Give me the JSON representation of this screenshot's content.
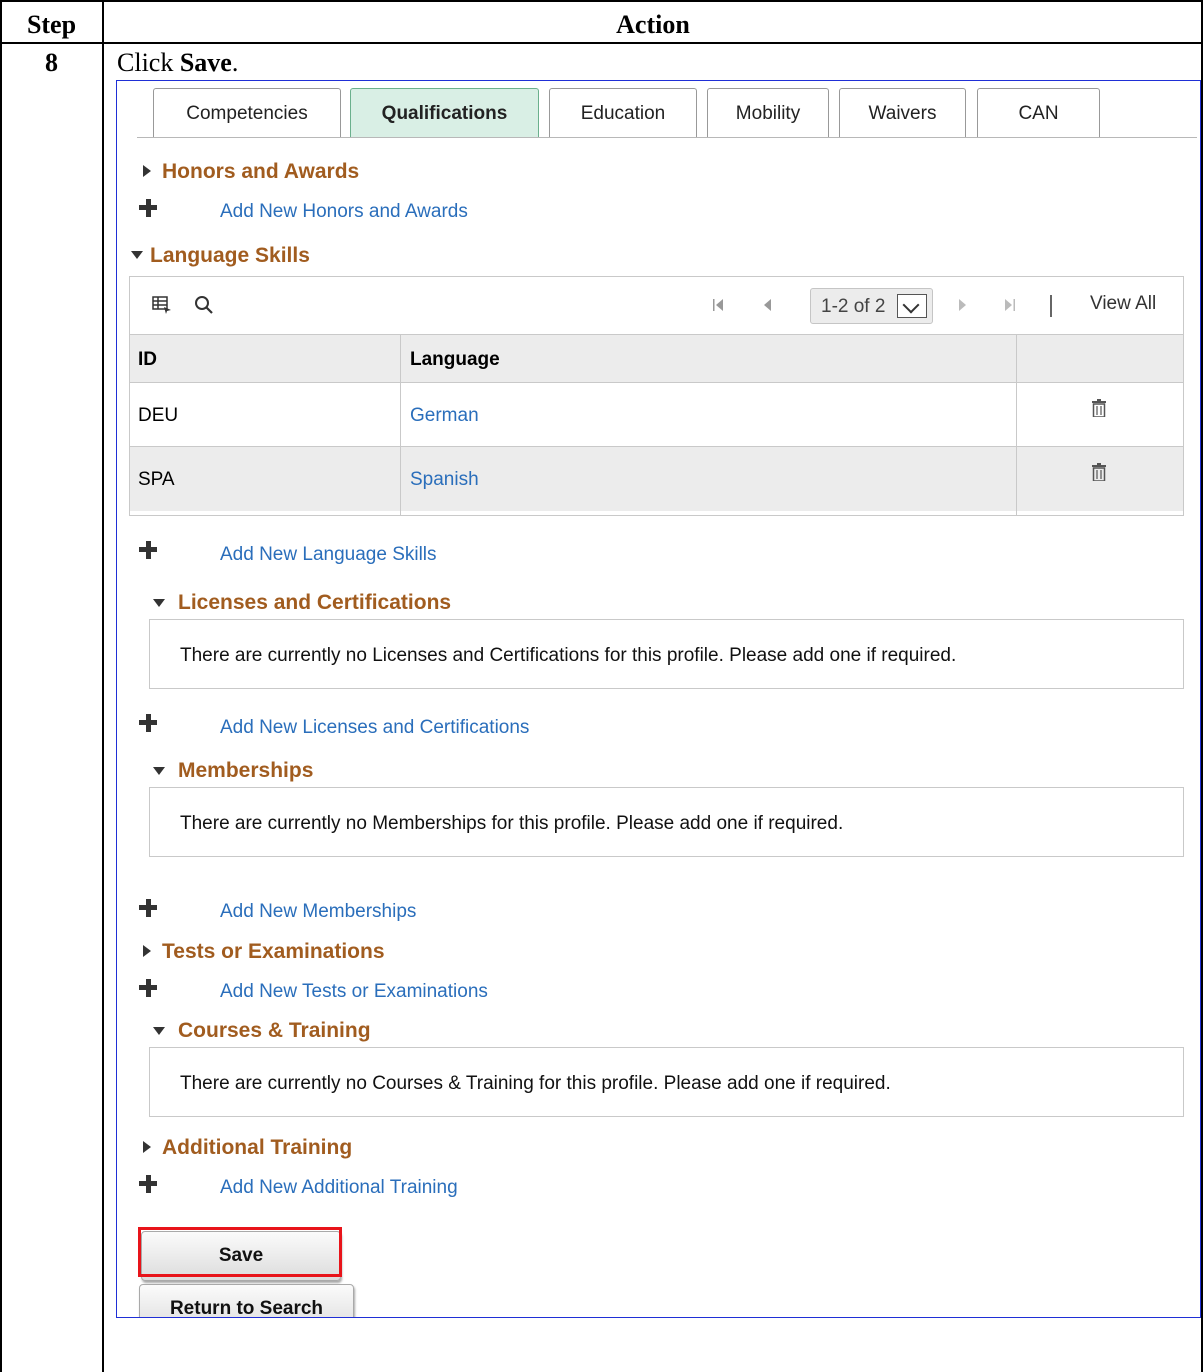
{
  "doc": {
    "header_step": "Step",
    "header_action": "Action",
    "step_number": "8",
    "instruction_prefix": "Click ",
    "instruction_bold": "Save",
    "instruction_suffix": "."
  },
  "tabs": [
    {
      "label": "Competencies",
      "active": false
    },
    {
      "label": "Qualifications",
      "active": true
    },
    {
      "label": "Education",
      "active": false
    },
    {
      "label": "Mobility",
      "active": false
    },
    {
      "label": "Waivers",
      "active": false
    },
    {
      "label": "CAN",
      "active": false
    }
  ],
  "sections": {
    "honors": {
      "title": "Honors and Awards",
      "add_label": "Add New Honors and Awards",
      "expanded": false
    },
    "language": {
      "title": "Language Skills",
      "add_label": "Add New Language Skills",
      "expanded": true
    },
    "licenses": {
      "title": "Licenses and Certifications",
      "add_label": "Add New Licenses and Certifications",
      "message": "There are currently no Licenses and Certifications for this profile.  Please add one if required.",
      "expanded": true
    },
    "memberships": {
      "title": "Memberships",
      "add_label": "Add New Memberships",
      "message": "There are currently no Memberships for this profile.  Please add one if required.",
      "expanded": true
    },
    "tests": {
      "title": "Tests or Examinations",
      "add_label": "Add New Tests or Examinations",
      "expanded": false
    },
    "courses": {
      "title": "Courses & Training",
      "message": "There are currently no Courses & Training for this profile.  Please add one if required.",
      "expanded": true
    },
    "additional": {
      "title": "Additional Training",
      "add_label": "Add New Additional Training",
      "expanded": false
    }
  },
  "language_grid": {
    "pager_text": "1-2 of 2",
    "view_all": "View All",
    "columns": [
      "ID",
      "Language"
    ],
    "rows": [
      {
        "id": "DEU",
        "language": "German"
      },
      {
        "id": "SPA",
        "language": "Spanish"
      }
    ]
  },
  "buttons": {
    "save": "Save",
    "return_to_search": "Return to Search"
  },
  "colors": {
    "section_title": "#a15c1f",
    "link": "#2a6ebb",
    "active_tab": "#d9efe5",
    "highlight": "#e8141a",
    "frame_border": "#1f2fd6"
  }
}
